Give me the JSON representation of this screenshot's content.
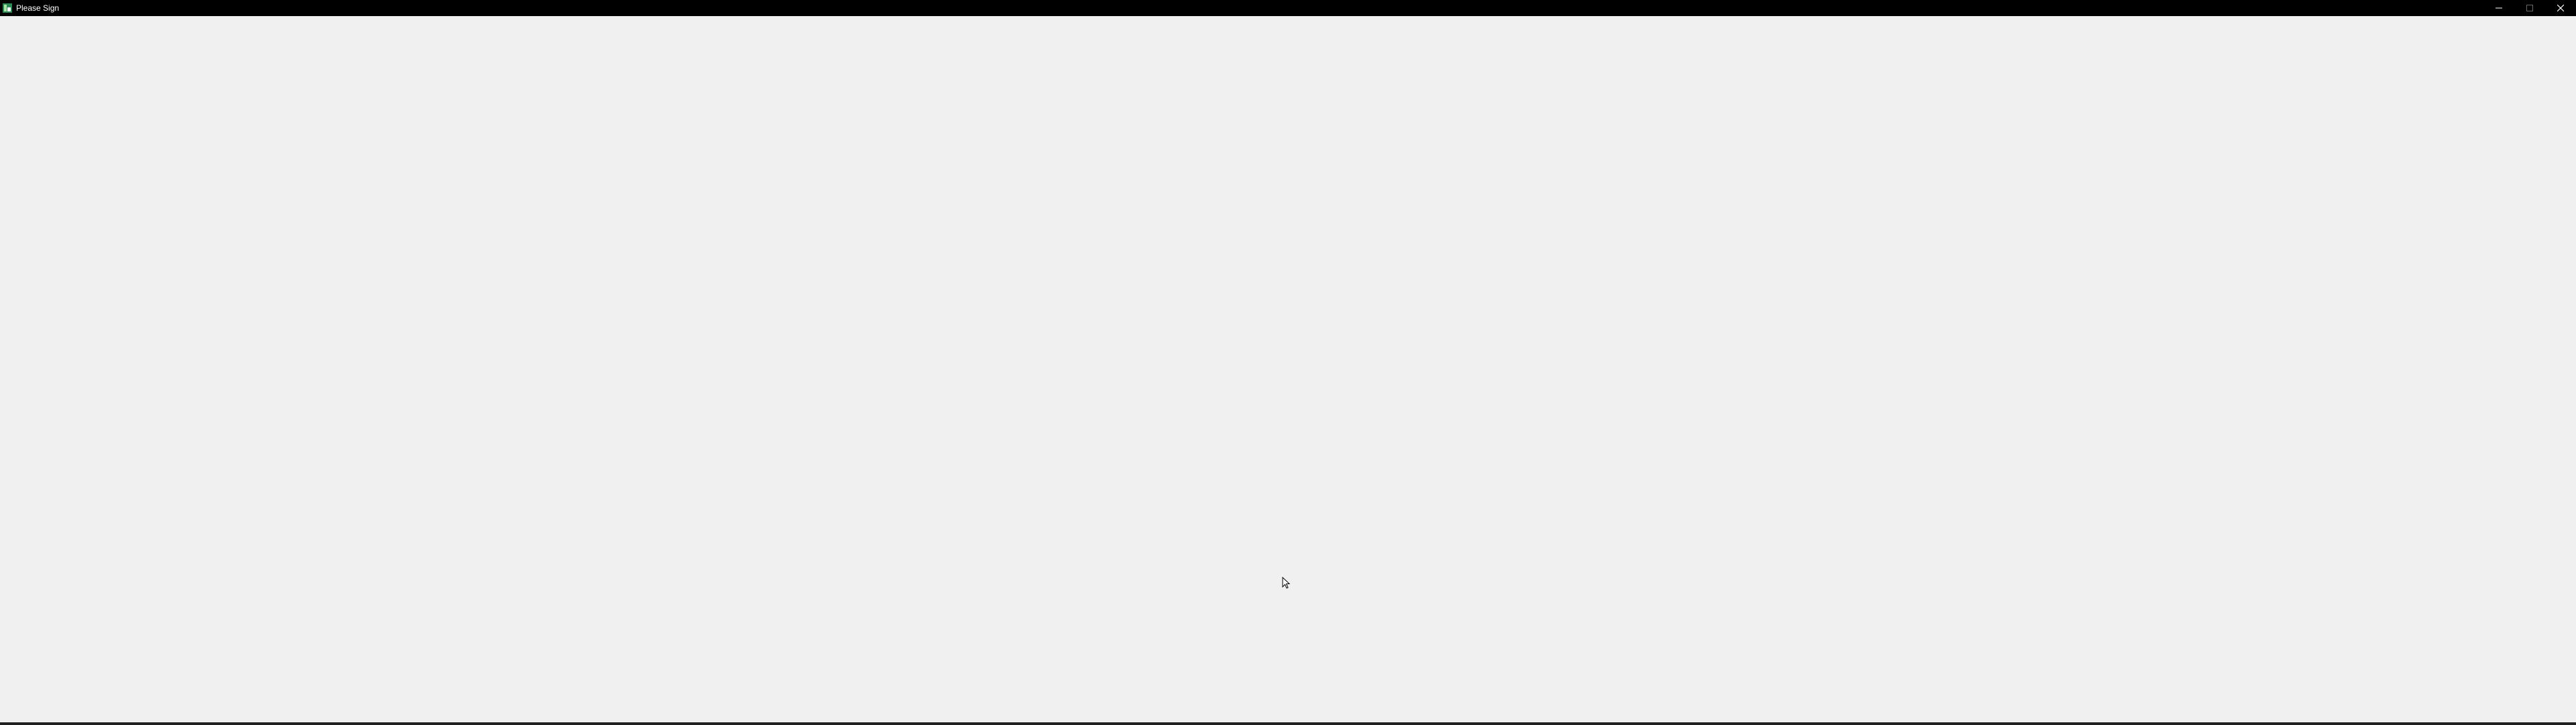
{
  "window": {
    "title": "Please Sign",
    "app_icon": "app-icon",
    "controls": {
      "minimize_icon": "minimize-icon",
      "maximize_icon": "maximize-icon",
      "close_icon": "close-icon"
    }
  },
  "colors": {
    "titlebar": "#000000",
    "title_text": "#ffffff",
    "client_background": "#f0f0f0",
    "app_icon_green": "#2e8b57"
  },
  "pointer": {
    "icon": "mouse-pointer-icon"
  }
}
